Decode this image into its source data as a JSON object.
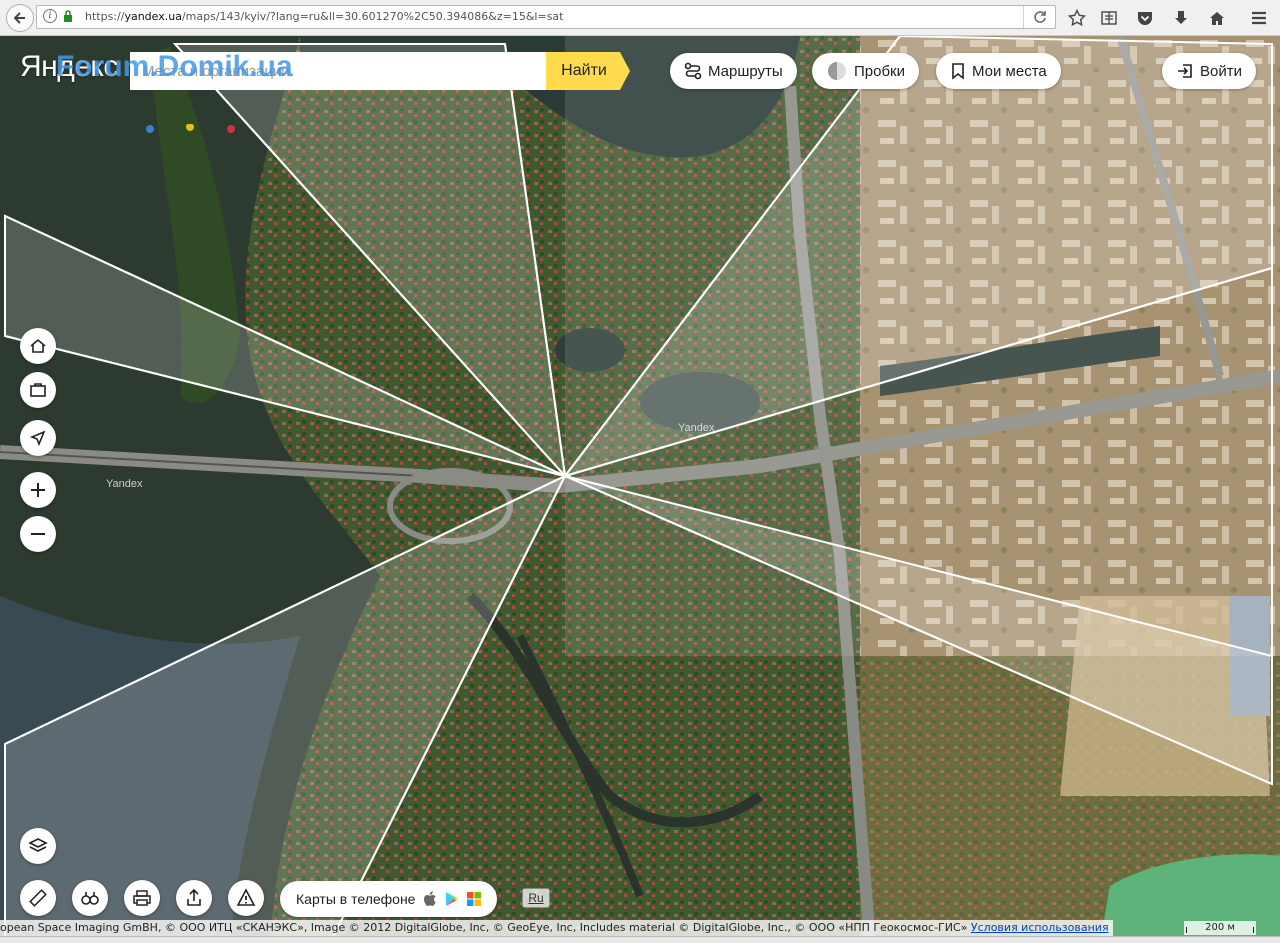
{
  "browser": {
    "url_prefix": "https://",
    "url_host": "yandex.ua",
    "url_path": "/maps/143/kyiv/?lang=ru&ll=30.601270%2C50.394086&z=15&l=sat",
    "icons": [
      "back-icon",
      "info-icon",
      "lock-icon",
      "reload-icon",
      "star-icon",
      "reading-list-icon",
      "pocket-icon",
      "download-icon",
      "home-icon",
      "menu-icon"
    ]
  },
  "header": {
    "logo": "Яндекс",
    "watermark": "Forum.Domik.ua",
    "search_placeholder": "Места и организации",
    "search_button": "Найти"
  },
  "toolbar": {
    "routes": "Маршруты",
    "traffic": "Пробки",
    "my_places": "Мои места",
    "login": "Войти"
  },
  "controls": {
    "left": [
      "home-icon",
      "briefcase-icon",
      "locate-icon",
      "zoom-in-icon",
      "zoom-out-icon"
    ],
    "bottom": [
      "layers-icon",
      "ruler-icon",
      "panorama-icon",
      "print-icon",
      "share-icon",
      "report-error-icon"
    ]
  },
  "footer": {
    "phone_promo": "Карты в телефоне",
    "language": "Ru",
    "copyright": "opean Space Imaging GmBH, © ООО ИТЦ «СКАНЭКС», Image © 2012 DigitalGlobe, Inc, © GeoEye, Inc, Includes material © DigitalGlobe, Inc., © ООО «НПП Геокосмос-ГИС»",
    "terms_link": "Условия использования",
    "scale": "200 м"
  },
  "map_labels": {
    "water_left": "Yandex",
    "water_right": "Yandex"
  },
  "colors": {
    "search_button": "#ffdb4d",
    "watermark": "#4696e6"
  }
}
